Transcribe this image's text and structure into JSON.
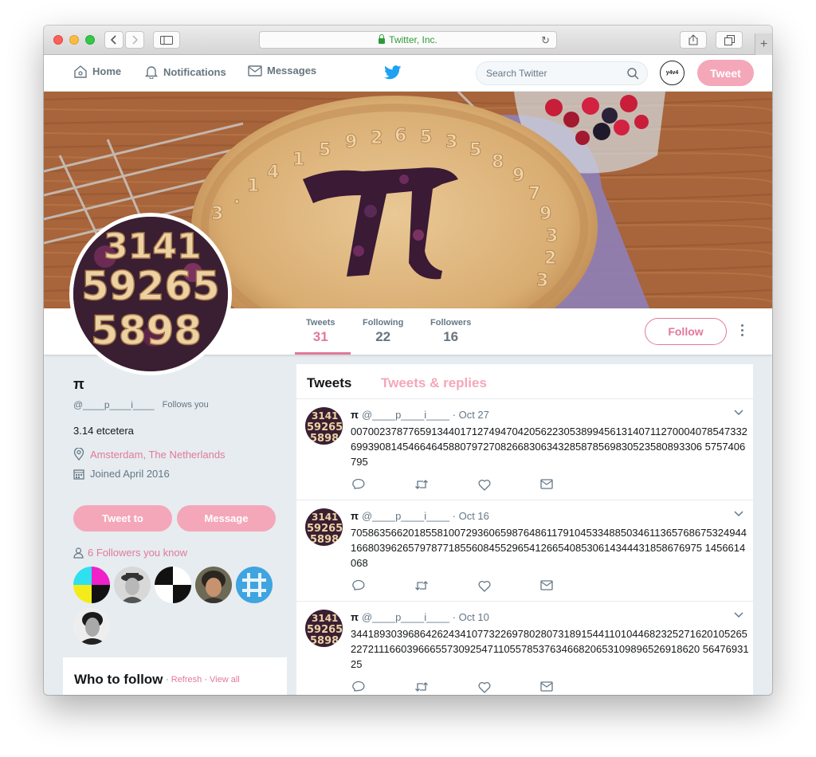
{
  "browser": {
    "url_title": "Twitter, Inc."
  },
  "nav": {
    "home": "Home",
    "notifications": "Notifications",
    "messages": "Messages",
    "search_placeholder": "Search Twitter",
    "tweet_button": "Tweet",
    "user_avatar_text": "y4v4"
  },
  "profile": {
    "name": "π",
    "handle": "@____p____i____",
    "follows_you": "Follows you",
    "bio": "3.14 etcetera",
    "location": "Amsterdam, The Netherlands",
    "joined": "Joined April 2016",
    "tweet_to": "Tweet to",
    "message": "Message",
    "followers_you_know": "6 Followers you know"
  },
  "stats": [
    {
      "label": "Tweets",
      "value": "31"
    },
    {
      "label": "Following",
      "value": "22"
    },
    {
      "label": "Followers",
      "value": "16"
    }
  ],
  "follow_button": "Follow",
  "timeline": {
    "tabs": [
      "Tweets",
      "Tweets & replies"
    ],
    "tweets": [
      {
        "name": "π",
        "handle": "@____p____i____",
        "date": "· Oct 27",
        "text": "0070023787765913440171274947042056223053899456131407112700040785473326993908145466464588079727082668306343285878569830523580893306 5757406795"
      },
      {
        "name": "π",
        "handle": "@____p____i____",
        "date": "· Oct 16",
        "text": "7058635662018558100729360659876486117910453348850346113657686753249441668039626579787718556084552965412665408530614344431858676975 1456614068"
      },
      {
        "name": "π",
        "handle": "@____p____i____",
        "date": "· Oct 10",
        "text": "3441893039686426243410773226978028073189154411010446823252716201052652272111660396665573092547110557853763466820653109896526918620 5647693125"
      }
    ]
  },
  "who_to_follow": {
    "title": "Who to follow",
    "refresh": "Refresh",
    "view_all": "View all"
  },
  "colors": {
    "accent": "#e2799a",
    "accent_light": "#f4a7b9",
    "twitter_blue": "#1da1f2"
  }
}
